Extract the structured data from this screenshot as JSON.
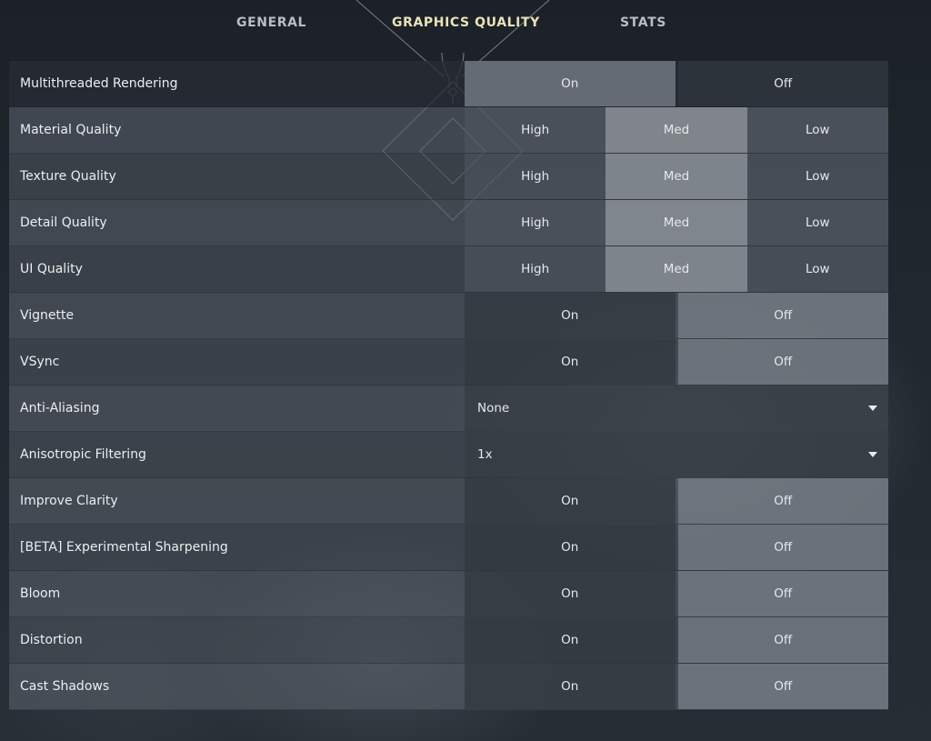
{
  "tabs": [
    {
      "label": "GENERAL",
      "active": false
    },
    {
      "label": "GRAPHICS QUALITY",
      "active": true
    },
    {
      "label": "STATS",
      "active": false
    }
  ],
  "settings": [
    {
      "label": "Multithreaded Rendering",
      "type": "toggle",
      "options": [
        "On",
        "Off"
      ],
      "selected": "On"
    },
    {
      "label": "Material Quality",
      "type": "tri",
      "options": [
        "High",
        "Med",
        "Low"
      ],
      "selected": "Med"
    },
    {
      "label": "Texture Quality",
      "type": "tri",
      "options": [
        "High",
        "Med",
        "Low"
      ],
      "selected": "Med"
    },
    {
      "label": "Detail Quality",
      "type": "tri",
      "options": [
        "High",
        "Med",
        "Low"
      ],
      "selected": "Med"
    },
    {
      "label": "UI Quality",
      "type": "tri",
      "options": [
        "High",
        "Med",
        "Low"
      ],
      "selected": "Med"
    },
    {
      "label": "Vignette",
      "type": "toggle",
      "options": [
        "On",
        "Off"
      ],
      "selected": "Off"
    },
    {
      "label": "VSync",
      "type": "toggle",
      "options": [
        "On",
        "Off"
      ],
      "selected": "Off"
    },
    {
      "label": "Anti-Aliasing",
      "type": "dropdown",
      "value": "None"
    },
    {
      "label": "Anisotropic Filtering",
      "type": "dropdown",
      "value": "1x"
    },
    {
      "label": "Improve Clarity",
      "type": "toggle",
      "options": [
        "On",
        "Off"
      ],
      "selected": "Off"
    },
    {
      "label": "[BETA] Experimental Sharpening",
      "type": "toggle",
      "options": [
        "On",
        "Off"
      ],
      "selected": "Off"
    },
    {
      "label": "Bloom",
      "type": "toggle",
      "options": [
        "On",
        "Off"
      ],
      "selected": "Off"
    },
    {
      "label": "Distortion",
      "type": "toggle",
      "options": [
        "On",
        "Off"
      ],
      "selected": "Off"
    },
    {
      "label": "Cast Shadows",
      "type": "toggle",
      "options": [
        "On",
        "Off"
      ],
      "selected": "Off"
    }
  ],
  "icons": {
    "dropdown": "chevron-down-icon",
    "ornament": "diamond-emblem-icon"
  },
  "colors": {
    "active_tab": "#e9e3b8",
    "tab": "#b9bec3"
  }
}
